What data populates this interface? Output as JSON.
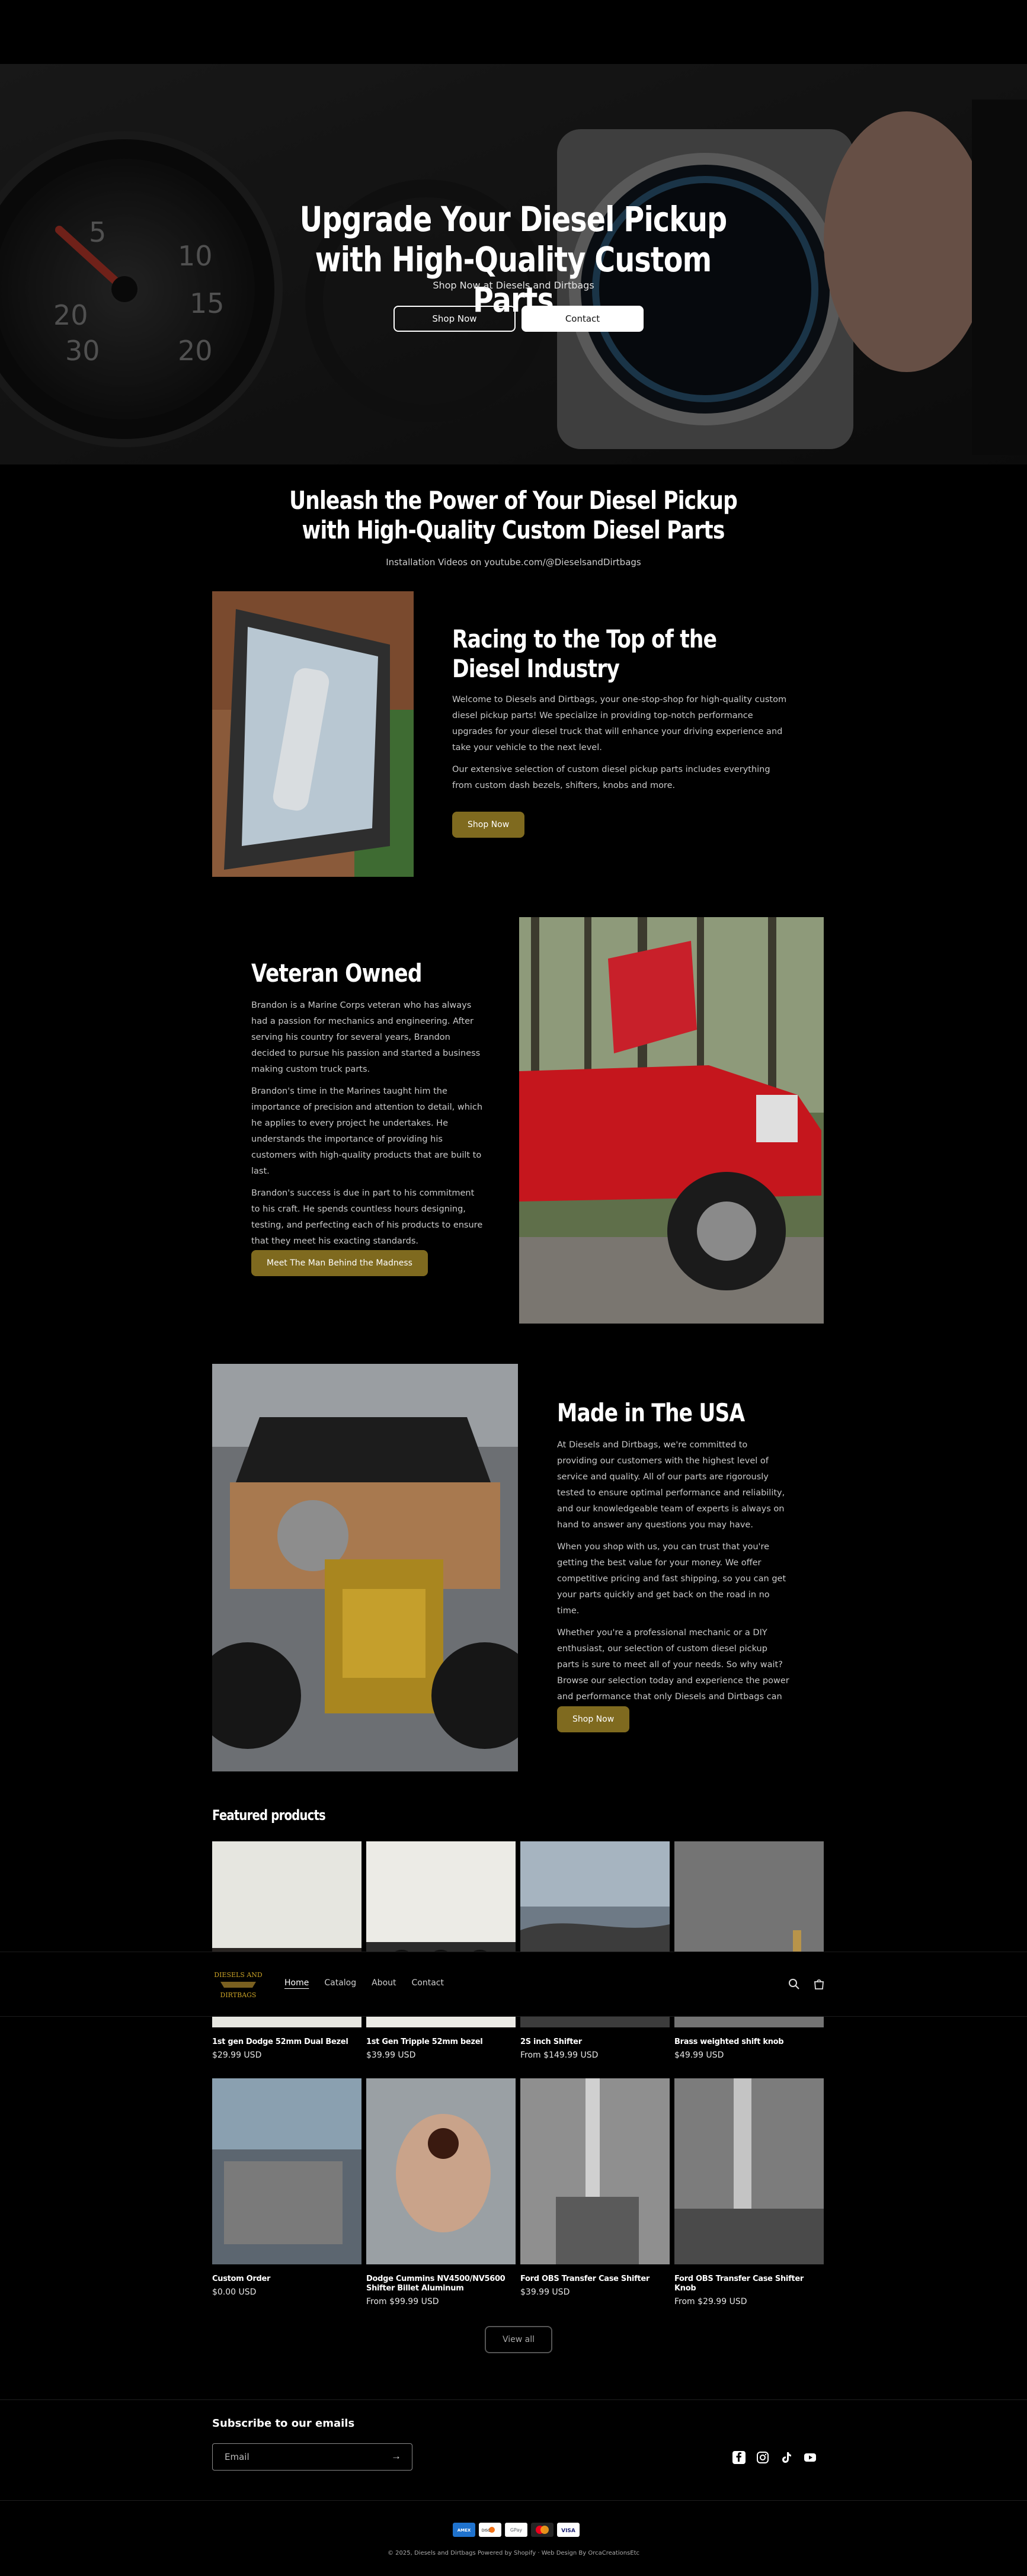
{
  "hero": {
    "title": "Upgrade Your Diesel Pickup with High-Quality Custom Parts",
    "subtitle": "Shop Now at Diesels and Dirtbags",
    "shop_button": "Shop Now",
    "contact_button": "Contact"
  },
  "intro": {
    "title": "Unleash the Power of Your Diesel Pickup with High-Quality Custom Diesel Parts",
    "subtitle": "Installation Videos on youtube.com/@DieselsandDirtbags"
  },
  "racing": {
    "title": "Racing to the Top of the Diesel Industry",
    "para1": "Welcome to Diesels and Dirtbags, your one-stop-shop for high-quality custom diesel pickup parts! We specialize in providing top-notch performance upgrades for your diesel truck that will enhance your driving experience and take your vehicle to the next level.",
    "para2": "Our extensive selection of custom diesel pickup parts includes everything from custom dash bezels, shifters, knobs and more.",
    "button": "Shop Now"
  },
  "veteran": {
    "title": "Veteran Owned",
    "para1": "Brandon is a Marine Corps veteran who has always had a passion for mechanics and engineering. After serving his country for several years, Brandon decided to pursue his passion and started a business making custom truck parts.",
    "para2": "Brandon's time in the Marines taught him the importance of precision and attention to detail, which he applies to every project he undertakes. He understands the importance of providing his customers with high-quality products that are built to last.",
    "para3": "Brandon's success is due in part to his commitment to his craft. He spends countless hours designing, testing, and perfecting each of his products to ensure that they meet his exacting standards.",
    "button": "Meet The Man Behind the Madness"
  },
  "usa": {
    "title": "Made in The USA",
    "para1": "At Diesels and Dirtbags, we're committed to providing our customers with the highest level of service and quality. All of our parts are rigorously tested to ensure optimal performance and reliability, and our knowledgeable team of experts is always on hand to answer any questions you may have.",
    "para2": "When you shop with us, you can trust that you're getting the best value for your money. We offer competitive pricing and fast shipping, so you can get your parts quickly and get back on the road in no time.",
    "para3": "Whether you're a professional mechanic or a DIY enthusiast, our selection of custom diesel pickup parts is sure to meet all of your needs. So why wait? Browse our selection today and experience the power and performance that only Diesels and Dirtbags can deliver!",
    "button": "Shop Now"
  },
  "featured": {
    "title": "Featured products",
    "products": [
      {
        "name": "1st gen Dodge 52mm Dual Bezel",
        "price": "$29.99 USD"
      },
      {
        "name": "1st Gen Tripple 52mm bezel",
        "price": "$39.99 USD"
      },
      {
        "name": "2S inch Shifter",
        "price": "From $149.99 USD"
      },
      {
        "name": "Brass weighted shift knob",
        "price": "$49.99 USD"
      },
      {
        "name": "Custom Order",
        "price": "$0.00 USD"
      },
      {
        "name": "Dodge Cummins NV4500/NV5600 Shifter Billet Aluminum",
        "price": "From $99.99 USD"
      },
      {
        "name": "Ford OBS Transfer Case Shifter",
        "price": "$39.99 USD"
      },
      {
        "name": "Ford OBS Transfer Case Shifter Knob",
        "price": "From $29.99 USD"
      }
    ],
    "view_all": "View all"
  },
  "header": {
    "logo_line1": "DIESELS AND",
    "logo_line2": "DIRTBAGS",
    "nav": [
      "Home",
      "Catalog",
      "About",
      "Contact"
    ]
  },
  "footer": {
    "subscribe_title": "Subscribe to our emails",
    "email_placeholder": "Email",
    "payments": [
      "AMEX",
      "DISC",
      "GPay",
      "MC",
      "VISA"
    ],
    "copyright": "© 2025, Diesels and Dirtbags Powered by Shopify · Web Design By OrcaCreationsEtc"
  },
  "colors": {
    "background": "#000000",
    "accent_gold": "#7f6a1f",
    "text_muted": "#c9c9c9"
  },
  "icons": [
    "search-icon",
    "cart-icon",
    "facebook-icon",
    "instagram-icon",
    "tiktok-icon",
    "youtube-icon",
    "arrow-right-icon"
  ]
}
